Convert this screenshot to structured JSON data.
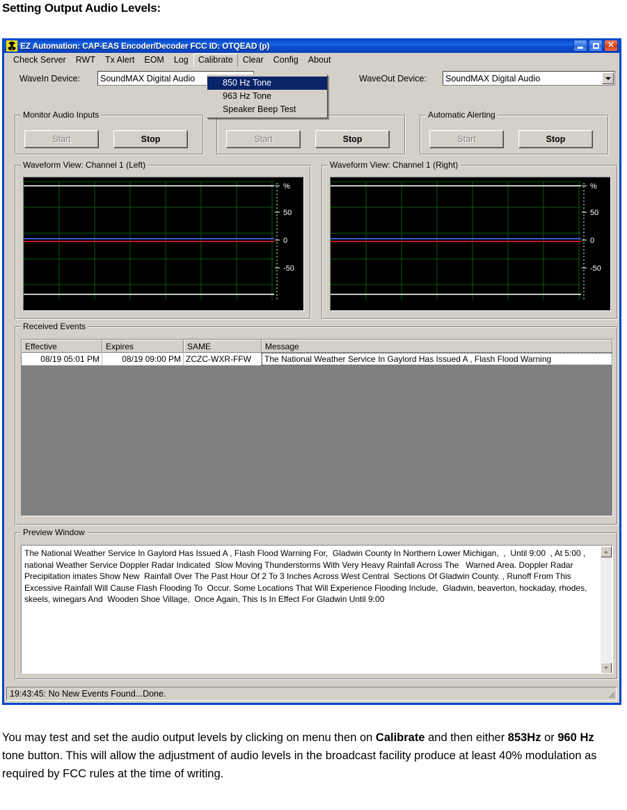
{
  "page": {
    "heading": "Setting Output Audio Levels:",
    "caption": {
      "part1": "You may test and set the audio output levels by clicking on menu then on ",
      "bold1": "Calibrate",
      "part2": " and then either ",
      "bold2": "853Hz",
      "part3": " or ",
      "bold3": "960 Hz",
      "part4": " tone button.  This will allow the adjustment of audio levels in the broadcast facility produce at least 40% modulation as required by FCC rules at the time of writing."
    }
  },
  "window": {
    "title": "EZ Automation:  CAP-EAS Encoder/Decoder  FCC ID: OTQEAD (p)",
    "icon": "radiation-icon",
    "buttons": {
      "minimize": "minimize-icon",
      "maximize": "maximize-icon",
      "close": "close-icon"
    }
  },
  "menubar": {
    "items": [
      {
        "label": "Check Server",
        "open": false
      },
      {
        "label": "RWT",
        "open": false
      },
      {
        "label": "Tx Alert",
        "open": false
      },
      {
        "label": "EOM",
        "open": false
      },
      {
        "label": "Log",
        "open": false
      },
      {
        "label": "Calibrate",
        "open": true
      },
      {
        "label": "Clear",
        "open": false
      },
      {
        "label": "Config",
        "open": false
      },
      {
        "label": "About",
        "open": false
      }
    ]
  },
  "calibrate_menu": {
    "items": [
      {
        "label": "850 Hz Tone",
        "selected": true
      },
      {
        "label": "963 Hz Tone",
        "selected": false
      },
      {
        "label": "Speaker Beep Test",
        "selected": false
      }
    ]
  },
  "devices": {
    "wavein_label": "WaveIn Device:",
    "wavein_value": "SoundMAX Digital Audio",
    "waveout_label": "WaveOut Device:",
    "waveout_value": "SoundMAX Digital Audio"
  },
  "groups": [
    {
      "title": "Monitor Audio Inputs",
      "start_label": "Start",
      "start_disabled": true,
      "stop_label": "Stop",
      "stop_disabled": false
    },
    {
      "title": "",
      "start_label": "Start",
      "start_disabled": true,
      "stop_label": "Stop",
      "stop_disabled": false
    },
    {
      "title": "Automatic Alerting",
      "start_label": "Start",
      "start_disabled": true,
      "stop_label": "Stop",
      "stop_disabled": false
    }
  ],
  "waveforms": [
    {
      "title": "Waveform View: Channel 1 (Left)",
      "axis_unit": "%",
      "axis_ticks": [
        "50",
        "0",
        "-50"
      ]
    },
    {
      "title": "Waveform View: Channel 1 (Right)",
      "axis_unit": "%",
      "axis_ticks": [
        "50",
        "0",
        "-50"
      ]
    }
  ],
  "received_events": {
    "title": "Received Events",
    "columns": [
      "Effective",
      "Expires",
      "SAME",
      "Message"
    ],
    "rows": [
      {
        "effective": "08/19 05:01 PM",
        "expires": "08/19 09:00 PM",
        "same": "ZCZC-WXR-FFW",
        "message": "The National Weather Service In Gaylord Has Issued A , Flash Flood Warning"
      }
    ]
  },
  "preview": {
    "title": "Preview Window",
    "text": "The National Weather Service In Gaylord Has Issued A , Flash Flood Warning For,  Gladwin County In Northern Lower Michigan,  ,  Until 9:00  , At 5:00 , national Weather Service Doppler Radar Indicated  Slow Moving Thunderstorms With Very Heavy Rainfall Across The   Warned Area. Doppler Radar Precipitation imates Show New  Rainfall Over The Past Hour Of 2 To 3 Inches Across West Central  Sections Of Gladwin County. , Runoff From This Excessive Rainfall Will Cause Flash Flooding To  Occur. Some Locations That Will Experience Flooding Include,  Gladwin, beaverton, hockaday, rhodes, skeels, winegars And  Wooden Shoe Village,  Once Again, This Is In Effect For Gladwin Until 9:00",
    "scroll_up": "scroll-up-icon",
    "scroll_down": "scroll-down-icon"
  },
  "statusbar": {
    "text": "19:43:45: No New Events Found...Done."
  },
  "colors": {
    "title_blue": "#0a46c8",
    "face": "#d4d0c8",
    "scope_bg": "#000000",
    "grid": "#0a5a0a",
    "menu_highlight": "#0a246a",
    "trace_blue": "#3a5ad8",
    "trace_red": "#c01818",
    "trace_white": "#c8c8c8"
  }
}
